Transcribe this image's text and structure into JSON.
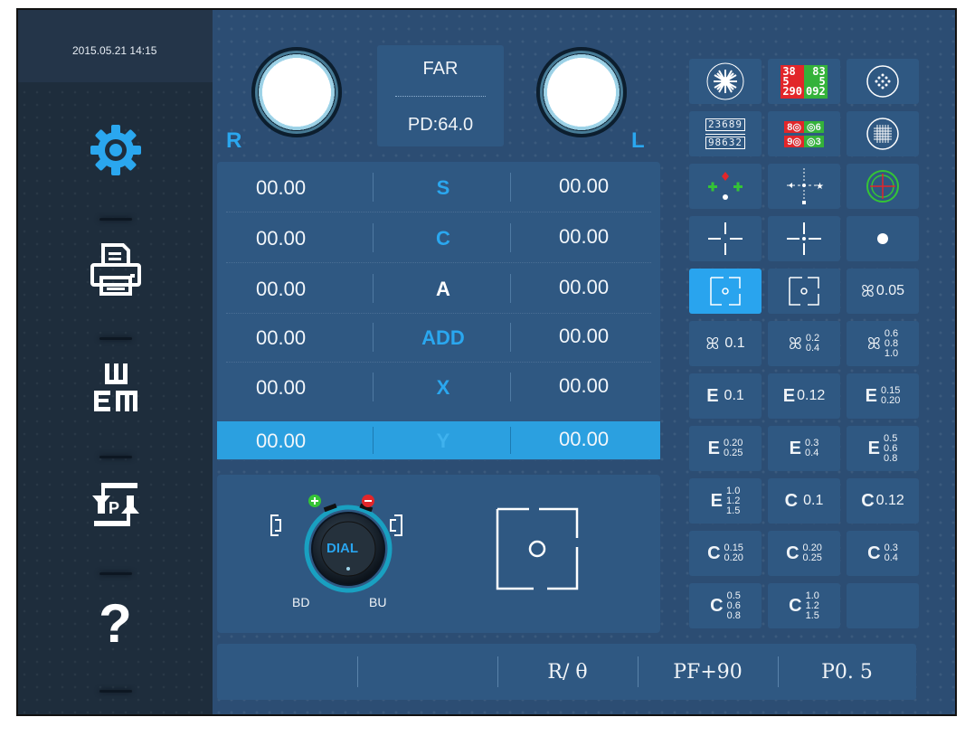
{
  "header": {
    "datetime": "2015.05.21 14:15"
  },
  "sidebar": {
    "items": [
      {
        "name": "settings",
        "icon": "gear-icon"
      },
      {
        "name": "print",
        "icon": "printer-icon"
      },
      {
        "name": "chart",
        "icon": "e-chart-icon"
      },
      {
        "name": "program",
        "icon": "program-p-icon"
      },
      {
        "name": "help",
        "icon": "help-icon",
        "label": "?"
      }
    ]
  },
  "lenses": {
    "right_label": "R",
    "left_label": "L"
  },
  "mode": {
    "distance": "FAR",
    "pd": "PD:64.0"
  },
  "measurements": [
    {
      "label": "S",
      "right": "00.00",
      "left": "00.00"
    },
    {
      "label": "C",
      "right": "00.00",
      "left": "00.00"
    },
    {
      "label": "A",
      "right": "00.00",
      "left": "00.00"
    },
    {
      "label": "ADD",
      "right": "00.00",
      "left": "00.00"
    },
    {
      "label": "X",
      "right": "00.00",
      "left": "00.00"
    },
    {
      "label": "Y",
      "right": "00.00",
      "left": "00.00"
    }
  ],
  "dial": {
    "label": "DIAL",
    "left_label": "BD",
    "right_label": "BU"
  },
  "charts": {
    "row1": [
      "astigmatism-clock-chart",
      "red-green-number-chart",
      "dot-cluster-chart"
    ],
    "row2": {
      "digits_top": "23689",
      "digits_bottom": "98632",
      "rg_top_left": "8◎",
      "rg_top_right": "◎6",
      "rg_bottom_left": "9◎",
      "rg_bottom_right": "◎3"
    },
    "row1_numbers": {
      "red_top": "38",
      "green_top": "83",
      "red_mid": "5",
      "green_mid": "5",
      "red_bottom": "290",
      "green_bottom": "092"
    },
    "acuity": {
      "butterfly_005": "0.05",
      "butterfly_01": "0.1",
      "butterfly_02_04": [
        "0.2",
        "0.4"
      ],
      "butterfly_06_10": [
        "0.6",
        "0.8",
        "1.0"
      ],
      "e_01": "0.1",
      "e_012": "0.12",
      "e_015_020": [
        "0.15",
        "0.20"
      ],
      "e_020_025": [
        "0.20",
        "0.25"
      ],
      "e_03_04": [
        "0.3",
        "0.4"
      ],
      "e_05_08": [
        "0.5",
        "0.6",
        "0.8"
      ],
      "e_10_15": [
        "1.0",
        "1.2",
        "1.5"
      ],
      "c_01": "0.1",
      "c_012": "0.12",
      "c_015_020": [
        "0.15",
        "0.20"
      ],
      "c_020_025": [
        "0.20",
        "0.25"
      ],
      "c_03_04": [
        "0.3",
        "0.4"
      ],
      "c_05_08": [
        "0.5",
        "0.6",
        "0.8"
      ],
      "c_10_15": [
        "1.0",
        "1.2",
        "1.5"
      ]
    }
  },
  "statusbar": {
    "cells": [
      "",
      "",
      "R/ θ",
      "PF+90",
      "P0. 5"
    ]
  },
  "colors": {
    "accent": "#29a4ee",
    "panel": "#2f5882",
    "background": "#2c4d73",
    "sidebar": "#1e2d3c"
  }
}
